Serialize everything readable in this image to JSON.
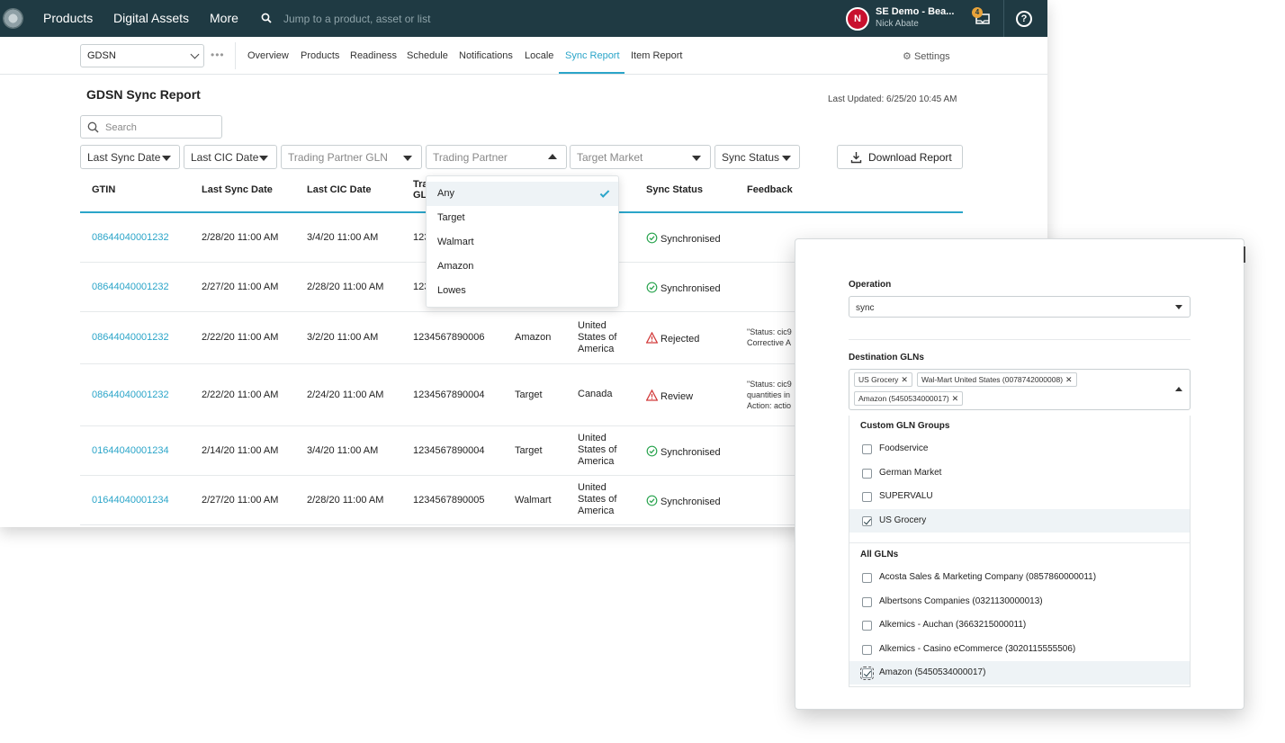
{
  "topbar": {
    "nav": [
      "Products",
      "Digital Assets",
      "More"
    ],
    "search_placeholder": "Jump to a product, asset or list",
    "user_initial": "N",
    "user_org": "SE Demo - Bea...",
    "user_name": "Nick Abate",
    "notif_count": "4",
    "help": "?"
  },
  "subnav": {
    "selector_value": "GDSN",
    "more": "•••",
    "tabs": [
      "Overview",
      "Products",
      "Readiness",
      "Schedule",
      "Notifications",
      "Locale",
      "Sync Report",
      "Item Report"
    ],
    "active_tab": "Sync Report",
    "settings": "Settings"
  },
  "report": {
    "title": "GDSN Sync Report",
    "last_updated": "Last Updated: 6/25/20 10:45 AM",
    "search_placeholder": "Search",
    "download_label": "Download Report",
    "filters": [
      "Last Sync Date",
      "Last CIC Date",
      "Trading Partner GLN",
      "Trading Partner",
      "Target Market",
      "Sync Status"
    ],
    "columns": [
      "GTIN",
      "Last Sync Date",
      "Last CIC Date",
      "Tra",
      "GL",
      "Sync Status",
      "Feedback"
    ],
    "rows": [
      {
        "gtin": "08644040001232",
        "sync": "2/28/20 11:00 AM",
        "cic": "3/4/20 11:00 AM",
        "gln": "123",
        "partner": "",
        "market": [
          "",
          "",
          ""
        ],
        "status": "Synchronised",
        "status_type": "ok",
        "feedback": [
          "",
          "",
          ""
        ]
      },
      {
        "gtin": "08644040001232",
        "sync": "2/27/20 11:00 AM",
        "cic": "2/28/20 11:00 AM",
        "gln": "123",
        "partner": "",
        "market": [
          "",
          "",
          ""
        ],
        "status": "Synchronised",
        "status_type": "ok",
        "feedback": [
          "",
          "",
          ""
        ]
      },
      {
        "gtin": "08644040001232",
        "sync": "2/22/20 11:00 AM",
        "cic": "3/2/20 11:00 AM",
        "gln": "1234567890006",
        "partner": "Amazon",
        "market": [
          "United",
          "States of",
          "America"
        ],
        "status": "Rejected",
        "status_type": "bad",
        "feedback": [
          "\"Status: cic9",
          "Corrective A",
          ""
        ]
      },
      {
        "gtin": "08644040001232",
        "sync": "2/22/20 11:00 AM",
        "cic": "2/24/20 11:00 AM",
        "gln": "1234567890004",
        "partner": "Target",
        "market": [
          "Canada",
          "",
          ""
        ],
        "status": "Review",
        "status_type": "bad",
        "feedback": [
          "\"Status: cic9",
          "quantities in",
          "Action: actio"
        ]
      },
      {
        "gtin": "01644040001234",
        "sync": "2/14/20 11:00 AM",
        "cic": "3/4/20 11:00 AM",
        "gln": "1234567890004",
        "partner": "Target",
        "market": [
          "United",
          "States of",
          "America"
        ],
        "status": "Synchronised",
        "status_type": "ok",
        "feedback": [
          "",
          "",
          ""
        ]
      },
      {
        "gtin": "01644040001234",
        "sync": "2/27/20 11:00 AM",
        "cic": "2/28/20 11:00 AM",
        "gln": "1234567890005",
        "partner": "Walmart",
        "market": [
          "United",
          "States of",
          "America"
        ],
        "status": "Synchronised",
        "status_type": "ok",
        "feedback": [
          "",
          "",
          ""
        ]
      }
    ]
  },
  "partner_dropdown": {
    "options": [
      "Any",
      "Target",
      "Walmart",
      "Amazon",
      "Lowes"
    ],
    "selected": "Any"
  },
  "modal": {
    "operation_label": "Operation",
    "operation_value": "sync",
    "destination_label": "Destination GLNs",
    "chips": [
      "US Grocery",
      "Wal-Mart United States (0078742000008)",
      "Amazon (5450534000017)"
    ],
    "custom_groups_title": "Custom GLN Groups",
    "custom_groups": [
      {
        "label": "Foodservice",
        "checked": false
      },
      {
        "label": "German Market",
        "checked": false
      },
      {
        "label": "SUPERVALU",
        "checked": false
      },
      {
        "label": "US Grocery",
        "checked": true
      }
    ],
    "all_glns_title": "All GLNs",
    "all_glns": [
      {
        "label": "Acosta Sales & Marketing Company (0857860000011)",
        "checked": false
      },
      {
        "label": "Albertsons Companies (0321130000013)",
        "checked": false
      },
      {
        "label": "Alkemics - Auchan (3663215000011)",
        "checked": false
      },
      {
        "label": "Alkemics - Casino eCommerce (3020115555506)",
        "checked": false
      },
      {
        "label": "Amazon (5450534000017)",
        "checked": true
      }
    ]
  },
  "colors": {
    "topbar": "#1f3a43",
    "accent": "#2ba5c9",
    "ok": "#2aa44f",
    "error": "#d23c3c",
    "avatar": "#c8102e"
  }
}
